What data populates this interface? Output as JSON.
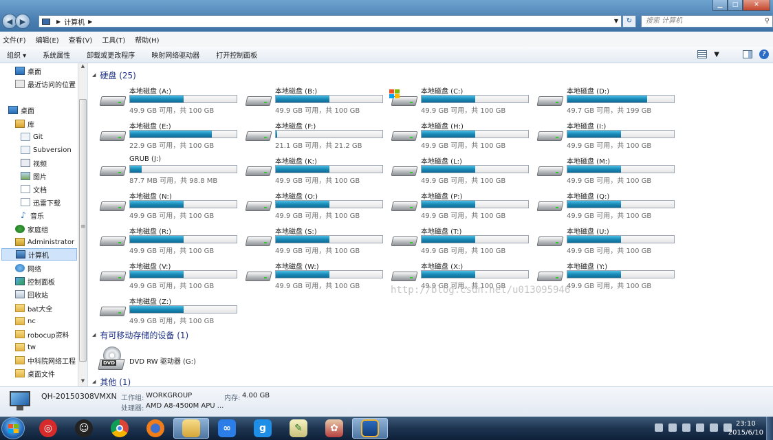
{
  "address": {
    "crumb": "计算机",
    "search_placeholder": "搜索 计算机"
  },
  "menu": [
    "文件(F)",
    "编辑(E)",
    "查看(V)",
    "工具(T)",
    "帮助(H)"
  ],
  "commands": [
    "组织 ▾",
    "系统属性",
    "卸载或更改程序",
    "映射网络驱动器",
    "打开控制面板"
  ],
  "sidebar": {
    "items": [
      {
        "label": "桌面",
        "icon": "desktop"
      },
      {
        "label": "最近访问的位置",
        "icon": "recent"
      },
      {
        "label": "桌面",
        "icon": "desktop"
      },
      {
        "label": "库",
        "icon": "library"
      },
      {
        "label": "Git",
        "icon": "git"
      },
      {
        "label": "Subversion",
        "icon": "svn"
      },
      {
        "label": "视频",
        "icon": "video"
      },
      {
        "label": "图片",
        "icon": "picture"
      },
      {
        "label": "文档",
        "icon": "document"
      },
      {
        "label": "迅雷下载",
        "icon": "download"
      },
      {
        "label": "音乐",
        "icon": "music"
      },
      {
        "label": "家庭组",
        "icon": "homegroup"
      },
      {
        "label": "Administrator",
        "icon": "user"
      },
      {
        "label": "计算机",
        "icon": "computer"
      },
      {
        "label": "网络",
        "icon": "network"
      },
      {
        "label": "控制面板",
        "icon": "control-panel"
      },
      {
        "label": "回收站",
        "icon": "recycle-bin"
      },
      {
        "label": "bat大全",
        "icon": "folder"
      },
      {
        "label": "nc",
        "icon": "folder"
      },
      {
        "label": "robocup资料",
        "icon": "folder"
      },
      {
        "label": "tw",
        "icon": "folder"
      },
      {
        "label": "中科院网络工程",
        "icon": "folder"
      },
      {
        "label": "桌面文件",
        "icon": "folder"
      }
    ]
  },
  "groups": {
    "hard_disks": "硬盘 (25)",
    "removable": "有可移动存储的设备 (1)",
    "other": "其他 (1)"
  },
  "drives": [
    {
      "name": "本地磁盘 (A:)",
      "free": "49.9 GB 可用，共 100 GB",
      "used": 0.5
    },
    {
      "name": "本地磁盘 (B:)",
      "free": "49.9 GB 可用，共 100 GB",
      "used": 0.5
    },
    {
      "name": "本地磁盘 (C:)",
      "free": "49.9 GB 可用，共 100 GB",
      "used": 0.5,
      "system": true
    },
    {
      "name": "本地磁盘 (D:)",
      "free": "49.7 GB 可用，共 199 GB",
      "used": 0.75
    },
    {
      "name": "本地磁盘 (E:)",
      "free": "22.9 GB 可用，共 100 GB",
      "used": 0.77
    },
    {
      "name": "本地磁盘 (F:)",
      "free": "21.1 GB 可用，共 21.2 GB",
      "used": 0.01
    },
    {
      "name": "本地磁盘 (H:)",
      "free": "49.9 GB 可用，共 100 GB",
      "used": 0.5
    },
    {
      "name": "本地磁盘 (I:)",
      "free": "49.9 GB 可用，共 100 GB",
      "used": 0.5
    },
    {
      "name": "GRUB (J:)",
      "free": "87.7 MB 可用，共 98.8 MB",
      "used": 0.11
    },
    {
      "name": "本地磁盘 (K:)",
      "free": "49.9 GB 可用，共 100 GB",
      "used": 0.5
    },
    {
      "name": "本地磁盘 (L:)",
      "free": "49.9 GB 可用，共 100 GB",
      "used": 0.5
    },
    {
      "name": "本地磁盘 (M:)",
      "free": "49.9 GB 可用，共 100 GB",
      "used": 0.5
    },
    {
      "name": "本地磁盘 (N:)",
      "free": "49.9 GB 可用，共 100 GB",
      "used": 0.5
    },
    {
      "name": "本地磁盘 (O:)",
      "free": "49.9 GB 可用，共 100 GB",
      "used": 0.5
    },
    {
      "name": "本地磁盘 (P:)",
      "free": "49.9 GB 可用，共 100 GB",
      "used": 0.5
    },
    {
      "name": "本地磁盘 (Q:)",
      "free": "49.9 GB 可用，共 100 GB",
      "used": 0.5
    },
    {
      "name": "本地磁盘 (R:)",
      "free": "49.9 GB 可用，共 100 GB",
      "used": 0.5
    },
    {
      "name": "本地磁盘 (S:)",
      "free": "49.9 GB 可用，共 100 GB",
      "used": 0.5
    },
    {
      "name": "本地磁盘 (T:)",
      "free": "49.9 GB 可用，共 100 GB",
      "used": 0.5
    },
    {
      "name": "本地磁盘 (U:)",
      "free": "49.9 GB 可用，共 100 GB",
      "used": 0.5
    },
    {
      "name": "本地磁盘 (V:)",
      "free": "49.9 GB 可用，共 100 GB",
      "used": 0.5
    },
    {
      "name": "本地磁盘 (W:)",
      "free": "49.9 GB 可用，共 100 GB",
      "used": 0.5
    },
    {
      "name": "本地磁盘 (X:)",
      "free": "49.9 GB 可用，共 100 GB",
      "used": 0.5
    },
    {
      "name": "本地磁盘 (Y:)",
      "free": "49.9 GB 可用，共 100 GB",
      "used": 0.5
    },
    {
      "name": "本地磁盘 (Z:)",
      "free": "49.9 GB 可用，共 100 GB",
      "used": 0.5
    }
  ],
  "dvd": {
    "name": "DVD RW 驱动器 (G:)",
    "badge": "DVD"
  },
  "watermark": "http://blog.csdn.net/u013095946",
  "details": {
    "computer_name": "QH-20150308VMXN",
    "workgroup_label": "工作组:",
    "workgroup_value": "WORKGROUP",
    "memory_label": "内存:",
    "memory_value": "4.00 GB",
    "cpu_label": "处理器:",
    "cpu_value": "AMD A8-4500M APU ..."
  },
  "taskbar": {
    "apps": [
      "netease-music",
      "qq",
      "chrome",
      "firefox",
      "explorer",
      "baidu-netdisk",
      "app-9",
      "notepad-chart",
      "anime-app",
      "virtualbox"
    ],
    "time": "23:10",
    "date": "2015/6/10"
  },
  "colors": {
    "accent": "#1e3287",
    "bar_fill": "#1a8ab8"
  }
}
